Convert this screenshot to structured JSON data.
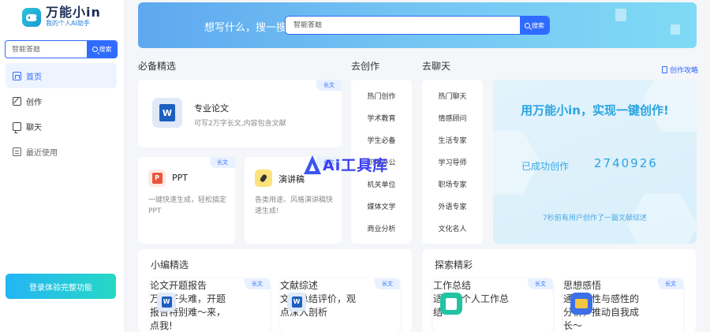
{
  "logo": {
    "title": "万能小in",
    "subtitle": "我的个人AI助手"
  },
  "sidebar": {
    "search_placeholder": "智能答题",
    "search_button": "搜索",
    "items": [
      {
        "label": "首页",
        "icon": "home-icon",
        "active": true
      },
      {
        "label": "创作",
        "icon": "edit-icon"
      },
      {
        "label": "聊天",
        "icon": "chat-icon"
      },
      {
        "label": "最近使用",
        "icon": "recent-icon"
      }
    ],
    "trial_button": "登录体验完整功能"
  },
  "banner": {
    "prompt": "想写什么，搜一搜",
    "search_placeholder": "智能答题",
    "search_button": "搜索"
  },
  "featured": {
    "title": "必备精选",
    "tag": "长文",
    "main": {
      "title": "专业论文",
      "desc": "可写2万字长文,内容包含文献"
    },
    "ppt": {
      "title": "PPT",
      "desc": "一键快速生成，轻松搞定PPT",
      "tag": "长文"
    },
    "speech": {
      "title": "演讲稿",
      "desc": "各类用途、风格演讲稿快速生成!",
      "tag": "长文"
    }
  },
  "create": {
    "title": "去创作",
    "items": [
      "热门创作",
      "学术教育",
      "学生必备",
      "职场办公",
      "机关单位",
      "媒体文学",
      "商业分析"
    ]
  },
  "chat": {
    "title": "去聊天",
    "items": [
      "热门聊天",
      "情感顾问",
      "生活专家",
      "学习导师",
      "职场专家",
      "外语专家",
      "文化名人"
    ]
  },
  "guide_link": "创作攻略",
  "promo": {
    "headline": "用万能小in，实现一键创作!",
    "count_label": "已成功创作",
    "count": "2740926",
    "recent": "7秒前有用户创作了一篇文献综述"
  },
  "editor_picks": {
    "title": "小编精选",
    "cards": [
      {
        "title": "论文开题报告",
        "desc": "万事开头难，开题报告特别难～来，点我!",
        "tag": "长文"
      },
      {
        "title": "文献综述",
        "desc": "文献总结评价，观点深入剖析",
        "tag": "长文"
      }
    ]
  },
  "explore": {
    "title": "探索精彩",
    "cards": [
      {
        "title": "工作总结",
        "desc": "适用于个人工作总结",
        "tag": "长文"
      },
      {
        "title": "思想感悟",
        "desc": "通过理性与感性的分析，推动自我成长～",
        "tag": "长文"
      }
    ]
  },
  "watermark": "Ai工具库",
  "colors": {
    "accent": "#2f6bff",
    "teal": "#27d8c5",
    "promo_text": "#2aa4e0"
  }
}
